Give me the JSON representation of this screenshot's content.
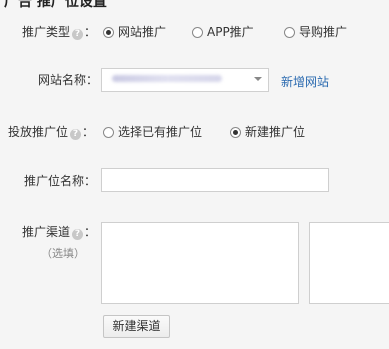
{
  "header": {
    "title_clipped": "广告 推广位设置"
  },
  "form": {
    "promo_type": {
      "label": "推广类型",
      "options": [
        {
          "label": "网站推广",
          "checked": true
        },
        {
          "label": "APP推广",
          "checked": false
        },
        {
          "label": "导购推广",
          "checked": false
        }
      ]
    },
    "site_name": {
      "label": "网站名称：",
      "value": "",
      "add_link": "新增网站"
    },
    "placement": {
      "label": "投放推广位",
      "options": [
        {
          "label": "选择已有推广位",
          "checked": false
        },
        {
          "label": "新建推广位",
          "checked": true
        }
      ]
    },
    "placement_name": {
      "label": "推广位名称：",
      "value": ""
    },
    "channel": {
      "label": "推广渠道",
      "optional": "（选填）",
      "new_button": "新建渠道"
    },
    "help_glyph": "?",
    "colon": "："
  }
}
